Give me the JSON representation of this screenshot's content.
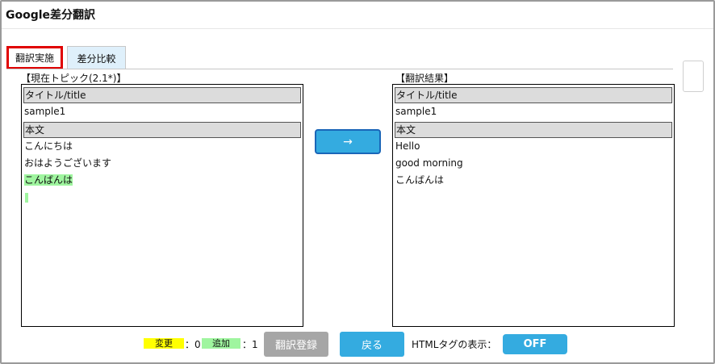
{
  "app": {
    "title": "Google差分翻訳"
  },
  "tabs": [
    {
      "label": "翻訳実施",
      "active": true
    },
    {
      "label": "差分比較",
      "active": false
    }
  ],
  "left_panel": {
    "label": "【現在トピック(2.1*)】",
    "rows": [
      {
        "text": "タイトル/title",
        "header": true
      },
      {
        "text": "sample1",
        "header": false
      },
      {
        "text": "本文",
        "header": true
      },
      {
        "text": "こんにちは",
        "header": false
      },
      {
        "text": "おはようございます",
        "header": false
      },
      {
        "text": "こんばんは",
        "header": false,
        "highlight": "added"
      }
    ]
  },
  "right_panel": {
    "label": "【翻訳結果】",
    "rows": [
      {
        "text": "タイトル/title",
        "header": true
      },
      {
        "text": "sample1",
        "header": false
      },
      {
        "text": "本文",
        "header": true
      },
      {
        "text": "Hello",
        "header": false
      },
      {
        "text": "good morning",
        "header": false
      },
      {
        "text": "こんばんは",
        "header": false
      }
    ]
  },
  "translate_button": {
    "label": "→"
  },
  "legend": {
    "changed_label": "変更",
    "changed_count": "：0",
    "changed_color": "#ffff00",
    "added_label": "追加",
    "added_count": "：1",
    "added_color": "#9ff59f"
  },
  "buttons": {
    "register_label": "翻訳登録",
    "back_label": "戻る"
  },
  "html_tag": {
    "label": "HTMLタグの表示：",
    "toggle_value": "OFF"
  }
}
